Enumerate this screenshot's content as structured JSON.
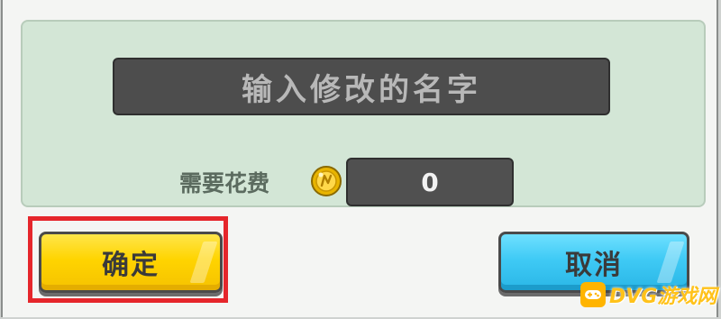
{
  "rename_dialog": {
    "name_input_placeholder": "输入修改的名字",
    "cost_label": "需要花费",
    "cost_value": "0",
    "currency_icon": "gold-coin-icon",
    "confirm_label": "确定",
    "cancel_label": "取消"
  },
  "watermark": {
    "text": "DVG游戏网",
    "icon": "gamepad-icon"
  },
  "colors": {
    "panel_bg": "#d3e6d6",
    "input_bg": "#4d4d4d",
    "confirm_button": "#ffd400",
    "cancel_button": "#3fcaf5",
    "highlight_border": "#e5262b"
  }
}
